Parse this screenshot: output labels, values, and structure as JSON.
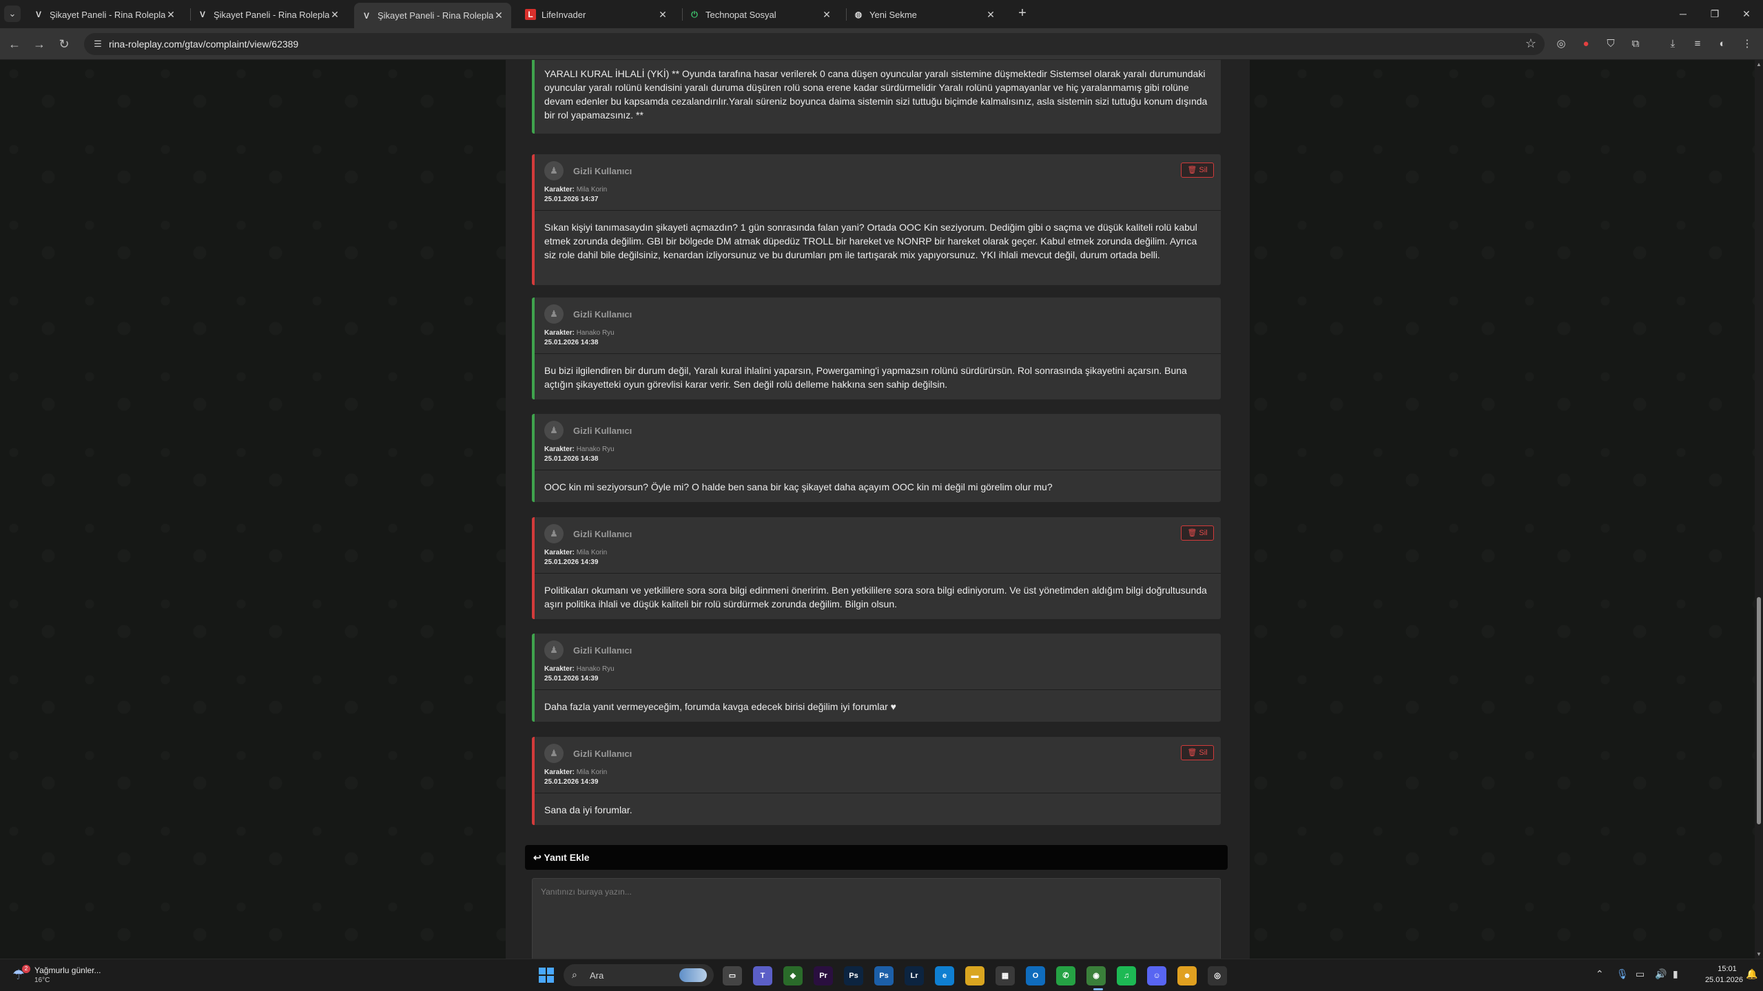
{
  "browser": {
    "tabs": [
      {
        "title": "Şikayet Paneli - Rina Roleplay G",
        "favicon": "V",
        "active": false
      },
      {
        "title": "Şikayet Paneli - Rina Roleplay G",
        "favicon": "V",
        "active": false
      },
      {
        "title": "Şikayet Paneli - Rina Roleplay G",
        "favicon": "V",
        "active": true
      },
      {
        "title": "LifeInvader",
        "favicon": "L",
        "active": false
      },
      {
        "title": "Technopat Sosyal",
        "favicon": "⏻",
        "active": false
      },
      {
        "title": "Yeni Sekme",
        "favicon": "◍",
        "active": false
      }
    ],
    "url": "rina-roleplay.com/gtav/complaint/view/62389",
    "colors": {
      "accent_green": "#3fa34d",
      "accent_red": "#d23b3b"
    }
  },
  "rule_text": "YARALI KURAL İHLALİ (YKİ) ** Oyunda tarafına hasar verilerek 0 cana düşen oyuncular yaralı sistemine düşmektedir Sistemsel olarak yaralı durumundaki oyuncular yaralı rolünü kendisini yaralı duruma düşüren rolü sona erene kadar sürdürmelidir Yaralı rolünü yapmayanlar ve hiç yaralanmamış gibi rolüne devam edenler bu kapsamda cezalandırılır.Yaralı süreniz boyunca daima sistemin sizi tuttuğu biçimde kalmalısınız, asla sistemin sizi tuttuğu konum dışında bir rol yapamazsınız. **",
  "labels": {
    "character": "Karakter:",
    "delete": "Sil"
  },
  "posts": [
    {
      "user": "Gizli Kullanıcı",
      "character": "Mila Korin",
      "date": "25.01.2026 14:37",
      "side": "red",
      "deletable": true,
      "text": "Sıkan kişiyi tanımasaydın şikayeti açmazdın? 1 gün sonrasında falan yani? Ortada OOC Kin seziyorum. Dediğim gibi o saçma ve düşük kaliteli rolü kabul etmek zorunda değilim. GBI bir bölgede DM atmak düpedüz TROLL bir hareket ve NONRP bir hareket olarak geçer. Kabul etmek zorunda değilim. Ayrıca siz role dahil bile değilsiniz, kenardan izliyorsunuz ve bu durumları pm ile tartışarak mix yapıyorsunuz. YKI ihlali mevcut değil, durum ortada belli."
    },
    {
      "user": "Gizli Kullanıcı",
      "character": "Hanako Ryu",
      "date": "25.01.2026 14:38",
      "side": "green",
      "deletable": false,
      "text": "Bu bizi ilgilendiren bir durum değil, Yaralı kural ihlalini yaparsın, Powergaming'i yapmazsın rolünü sürdürürsün. Rol sonrasında şikayetini açarsın. Buna açtığın şikayetteki oyun görevlisi karar verir. Sen değil rolü delleme hakkına sen sahip değilsin."
    },
    {
      "user": "Gizli Kullanıcı",
      "character": "Hanako Ryu",
      "date": "25.01.2026 14:38",
      "side": "green",
      "deletable": false,
      "text": "OOC kin mi seziyorsun? Öyle mi? O halde ben sana bir kaç şikayet daha açayım OOC kin mi değil mi görelim olur mu?"
    },
    {
      "user": "Gizli Kullanıcı",
      "character": "Mila Korin",
      "date": "25.01.2026 14:39",
      "side": "red",
      "deletable": true,
      "text": "Politikaları okumanı ve yetkililere sora sora bilgi edinmeni öneririm. Ben yetkililere sora sora bilgi ediniyorum. Ve üst yönetimden aldığım bilgi doğrultusunda aşırı politika ihlali ve düşük kaliteli bir rolü sürdürmek zorunda değilim. Bilgin olsun."
    },
    {
      "user": "Gizli Kullanıcı",
      "character": "Hanako Ryu",
      "date": "25.01.2026 14:39",
      "side": "green",
      "deletable": false,
      "text": "Daha fazla yanıt vermeyeceğim, forumda kavga edecek birisi değilim iyi forumlar ♥"
    },
    {
      "user": "Gizli Kullanıcı",
      "character": "Mila Korin",
      "date": "25.01.2026 14:39",
      "side": "red",
      "deletable": true,
      "text": "Sana da iyi forumlar."
    }
  ],
  "reply": {
    "header": "Yanıt Ekle",
    "placeholder": "Yanıtınızı buraya yazın..."
  },
  "taskbar": {
    "weather_text": "Yağmurlu günler...",
    "weather_temp": "16°C",
    "weather_badge": "2",
    "search_placeholder": "Ara",
    "time": "15:01",
    "date": "25.01.2026",
    "apps": [
      {
        "name": "task-view",
        "label": "▭",
        "color": "#444444"
      },
      {
        "name": "teams",
        "label": "T",
        "color": "#5b5fc7"
      },
      {
        "name": "gaming",
        "label": "◆",
        "color": "#2a6b2a"
      },
      {
        "name": "premiere",
        "label": "Pr",
        "color": "#2a0f3f"
      },
      {
        "name": "photoshop",
        "label": "Ps",
        "color": "#0c2440"
      },
      {
        "name": "photoshop-express",
        "label": "Ps",
        "color": "#1c5fa8"
      },
      {
        "name": "lightroom",
        "label": "Lr",
        "color": "#0c2440"
      },
      {
        "name": "edge",
        "label": "e",
        "color": "#0f7fd1"
      },
      {
        "name": "file-explorer",
        "label": "▬",
        "color": "#d9a520"
      },
      {
        "name": "store",
        "label": "▦",
        "color": "#3a3a3a"
      },
      {
        "name": "outlook",
        "label": "O",
        "color": "#0f6cbd"
      },
      {
        "name": "whatsapp",
        "label": "✆",
        "color": "#25a244"
      },
      {
        "name": "chrome",
        "label": "◉",
        "color": "#3a7f3a"
      },
      {
        "name": "spotify",
        "label": "♫",
        "color": "#1db954"
      },
      {
        "name": "discord",
        "label": "☺",
        "color": "#5865f2"
      },
      {
        "name": "app-yellow",
        "label": "☻",
        "color": "#e0a020"
      },
      {
        "name": "app-ring",
        "label": "◎",
        "color": "#333333"
      }
    ]
  }
}
